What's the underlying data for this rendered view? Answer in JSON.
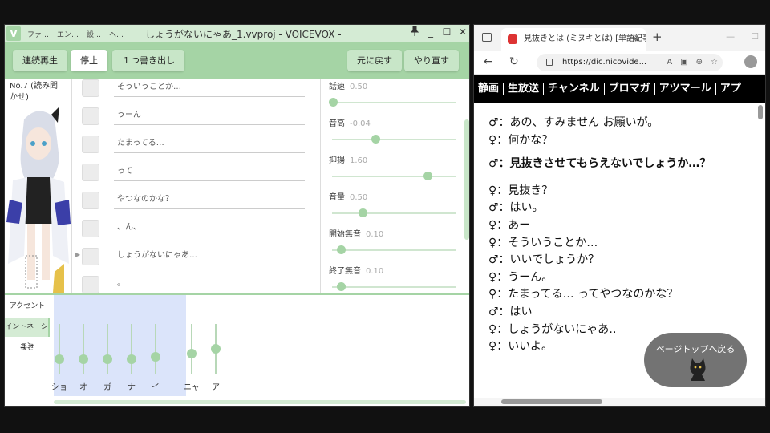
{
  "voicevox": {
    "logo": "V",
    "menu": [
      "ファ…",
      "エン…",
      "設…",
      "ヘ…"
    ],
    "title": "しょうがないにゃあ_1.vvproj - VOICEVOX -",
    "winctl": {
      "pin": "📌",
      "min": "_",
      "max": "☐",
      "close": "✕"
    },
    "toolbar": {
      "play_all": "連続再生",
      "stop": "停止",
      "export_one": "１つ書き出し",
      "undo": "元に戻す",
      "redo": "やり直す"
    },
    "character_label": "No.7 (読み聞かせ)",
    "script_lines": [
      "そういうことか…",
      "うーん",
      "たまってる…",
      "って",
      "やつなのかな？",
      "、ん、",
      "しょうがないにゃあ…",
      "。"
    ],
    "add_button": "+",
    "params": [
      {
        "label": "話速",
        "value": "0.50",
        "level": 0.0
      },
      {
        "label": "音高",
        "value": "-0.04",
        "level": 0.36
      },
      {
        "label": "抑揚",
        "value": "1.60",
        "level": 0.8
      },
      {
        "label": "音量",
        "value": "0.50",
        "level": 0.25
      },
      {
        "label": "開始無音",
        "value": "0.10",
        "level": 0.07
      },
      {
        "label": "終了無音",
        "value": "0.10",
        "level": 0.07
      }
    ],
    "bottom_tabs": [
      "アクセント",
      "イントネーション",
      "長さ"
    ],
    "active_tab": "イントネーション",
    "moras": [
      {
        "ch": "ショ",
        "level": 0.2
      },
      {
        "ch": "オ",
        "level": 0.2
      },
      {
        "ch": "ガ",
        "level": 0.2
      },
      {
        "ch": "ナ",
        "level": 0.2
      },
      {
        "ch": "イ",
        "level": 0.25
      },
      {
        "ch": "ニャ",
        "level": 0.3
      },
      {
        "ch": "ア",
        "level": 0.4
      }
    ]
  },
  "browser": {
    "tab_title": "見抜きとは (ミヌキとは) [単語記事]",
    "tab_close": "✕",
    "new_tab": "+",
    "window_ctl": [
      "—",
      "☐"
    ],
    "url": "https://dic.nicovide...",
    "nav_items": [
      "静画",
      "生放送",
      "チャンネル",
      "ブロマガ",
      "アツマール",
      "アプ"
    ],
    "article_lines": [
      {
        "text": "♂：あの、すみません お願いが。",
        "bold": false
      },
      {
        "text": "♀：何かな？",
        "bold": false
      },
      {
        "text": "♂：見抜きさせてもらえないでしょうか…？",
        "bold": true
      },
      {
        "text": "♀：見抜き？",
        "bold": false
      },
      {
        "text": "♂：はい。",
        "bold": false
      },
      {
        "text": "♀：あー",
        "bold": false
      },
      {
        "text": "♀：そういうことか…",
        "bold": false
      },
      {
        "text": "♂：いいでしょうか？",
        "bold": false
      },
      {
        "text": "♀：うーん。",
        "bold": false
      },
      {
        "text": "♀：たまってる… ってやつなのかな？",
        "bold": false
      },
      {
        "text": "♂：はい",
        "bold": false
      },
      {
        "text": "♀：しょうがないにゃあ‥",
        "bold": false
      },
      {
        "text": "♀：いいよ。",
        "bold": false
      }
    ],
    "back_to_top": "ページトップへ戻る"
  },
  "colors": {
    "voicevox_accent": "#a5d4a5",
    "voicevox_light": "#d4ebd4",
    "accent_area_bg": "#dbe4fa",
    "nico_nav_bg": "#000000"
  }
}
